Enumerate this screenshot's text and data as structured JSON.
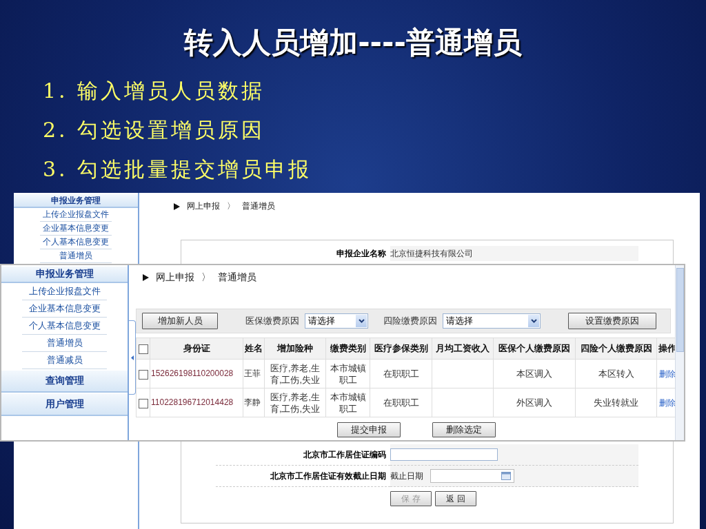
{
  "slide": {
    "title": "转入人员增加----普通增员",
    "steps": [
      "1. 输入增员人员数据",
      "2. 勾选设置增员原因",
      "3. 勾选批量提交增员申报"
    ]
  },
  "back_window": {
    "sidebar": {
      "header": "申报业务管理",
      "items": [
        "上传企业报盘文件",
        "企业基本信息变更",
        "个人基本信息变更",
        "普通增员"
      ]
    },
    "breadcrumb": {
      "items": [
        "网上申报",
        "普通增员"
      ],
      "separator": "〉"
    },
    "company": {
      "label": "申报企业名称",
      "value": "北京恒捷科技有限公司"
    },
    "fields": [
      {
        "kind": "text",
        "label": "北京市工作居住证编码"
      },
      {
        "kind": "date",
        "label": "北京市工作居住证有效截止日期",
        "prefix": "截止日期"
      }
    ],
    "buttons": [
      {
        "label": "保 存",
        "disabled": true
      },
      {
        "label": "返 回",
        "disabled": false
      }
    ]
  },
  "front_window": {
    "sidebar": {
      "sections": [
        {
          "title": "申报业务管理",
          "items": [
            "上传企业报盘文件",
            "企业基本信息变更",
            "个人基本信息变更",
            "普通增员",
            "普通减员"
          ]
        },
        {
          "title": "查询管理"
        },
        {
          "title": "用户管理"
        }
      ]
    },
    "breadcrumb": {
      "items": [
        "网上申报",
        "普通增员"
      ],
      "separator": "〉"
    },
    "toolbar": {
      "add_button": "增加新人员",
      "filters": [
        {
          "label": "医保缴费原因",
          "value": "请选择"
        },
        {
          "label": "四险缴费原因",
          "value": "请选择"
        }
      ],
      "set_button": "设置缴费原因"
    },
    "table": {
      "select_all": {
        "checked": false
      },
      "columns": [
        "身份证",
        "姓名",
        "增加险种",
        "缴费类别",
        "医疗参保类别",
        "月均工资收入",
        "医保个人缴费原因",
        "四险个人缴费原因",
        "操作"
      ],
      "rows": [
        {
          "checked": false,
          "id_number": "152626198110200028",
          "name": "王菲",
          "insurance_types": "医疗,养老,生育,工伤,失业",
          "payment_category": "本市城镇职工",
          "medical_category": "在职职工",
          "medical_reason": "本区调入",
          "four_insurance_reason": "本区转入",
          "action": "删除"
        },
        {
          "checked": false,
          "id_number": "110228196712014428",
          "name": "李静",
          "insurance_types": "医疗,养老,生育,工伤,失业",
          "payment_category": "本市城镇职工",
          "medical_category": "在职职工",
          "medical_reason": "外区调入",
          "four_insurance_reason": "失业转就业",
          "action": "删除"
        }
      ]
    },
    "buttons": [
      "提交申报",
      "删除选定"
    ]
  }
}
